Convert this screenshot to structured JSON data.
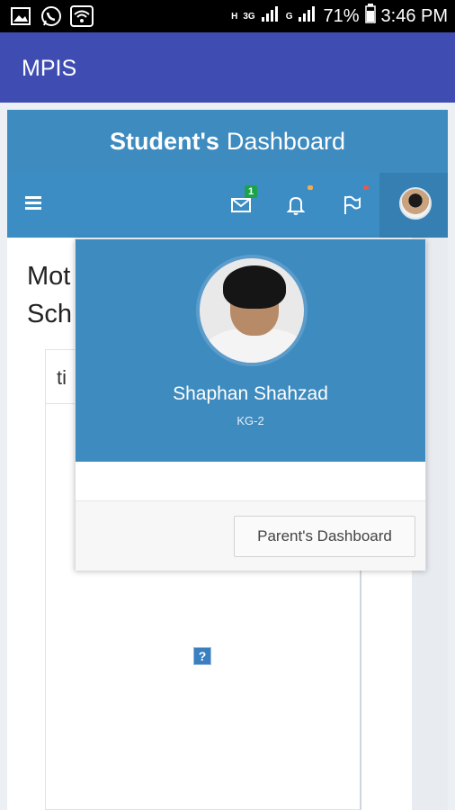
{
  "status_bar": {
    "battery": "71%",
    "time": "3:46 PM",
    "network_1": "3G",
    "network_2": "G",
    "network_h": "H"
  },
  "app": {
    "title": "MPIS"
  },
  "dashboard": {
    "title_bold": "Student's",
    "title_rest": "Dashboard",
    "mail_badge": "1",
    "colors": {
      "primary": "#3e8bbf",
      "appbar": "#3f4db3",
      "badge": "#1aa34a",
      "bell_dot": "#f0ad4e",
      "flag_dot": "#e05c4f"
    }
  },
  "background": {
    "heading_line1": "Mot",
    "heading_line2": "Sch",
    "frame_text": "ti",
    "missing_image_glyph": "?"
  },
  "profile_menu": {
    "name": "Shaphan Shahzad",
    "class": "KG-2",
    "parent_dashboard_label": "Parent's Dashboard"
  }
}
